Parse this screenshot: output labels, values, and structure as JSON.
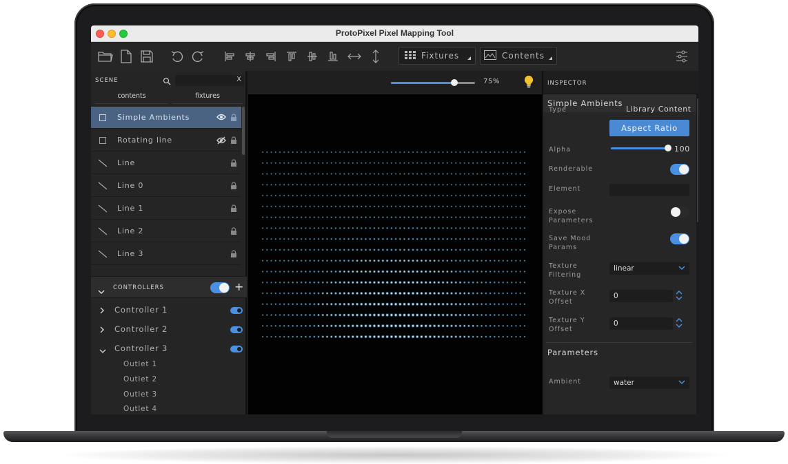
{
  "window": {
    "title": "ProtoPixel Pixel Mapping Tool"
  },
  "toolbar": {
    "fixtures_label": "Fixtures",
    "contents_label": "Contents",
    "icons": [
      "open-folder-icon",
      "new-file-icon",
      "save-icon",
      "undo-icon",
      "redo-icon",
      "align-left-icon",
      "align-center-horizontal-icon",
      "align-right-icon",
      "align-top-icon",
      "align-center-vertical-icon",
      "align-bottom-icon",
      "distribute-horizontal-icon",
      "distribute-vertical-icon",
      "grid-icon",
      "image-icon",
      "sliders-icon"
    ]
  },
  "scene": {
    "header": "SCENE",
    "search_clear": "X",
    "tabs": [
      "contents",
      "fixtures"
    ],
    "items": [
      {
        "label": "Simple Ambients",
        "kind": "content",
        "selected": true,
        "visible": true
      },
      {
        "label": "Rotating line",
        "kind": "content",
        "selected": false,
        "visible": false
      },
      {
        "label": "Line",
        "kind": "line"
      },
      {
        "label": "Line 0",
        "kind": "line"
      },
      {
        "label": "Line 1",
        "kind": "line"
      },
      {
        "label": "Line 2",
        "kind": "line"
      },
      {
        "label": "Line 3",
        "kind": "line"
      }
    ]
  },
  "controllers": {
    "header": "CONTROLLERS",
    "add_label": "+",
    "enabled": true,
    "items": [
      {
        "label": "Controller 1",
        "expanded": false
      },
      {
        "label": "Controller 2",
        "expanded": false
      },
      {
        "label": "Controller 3",
        "expanded": true
      }
    ],
    "outlets": [
      "Outlet 1",
      "Outlet 2",
      "Outlet 3",
      "Outlet 4"
    ]
  },
  "canvas": {
    "zoom_label": "75%",
    "zoom_fraction": 0.75,
    "led_rows": 18,
    "led_cols": 62
  },
  "inspector": {
    "header": "INSPECTOR",
    "title": "Simple Ambients",
    "type_label": "Type",
    "type_value": "Library Content",
    "aspect_button": "Aspect Ratio",
    "alpha_label": "Alpha",
    "alpha_value": "100",
    "renderable_label": "Renderable",
    "element_label": "Element",
    "expose_label_1": "Expose",
    "expose_label_2": "Parameters",
    "save_label_1": "Save Mood",
    "save_label_2": "Params",
    "filtering_label_1": "Texture",
    "filtering_label_2": "Filtering",
    "filtering_value": "linear",
    "offset_x_label_1": "Texture X",
    "offset_x_label_2": "Offset",
    "offset_x_value": "0",
    "offset_y_label_1": "Texture Y",
    "offset_y_label_2": "Offset",
    "offset_y_value": "0",
    "parameters_header": "Parameters",
    "ambient_label": "Ambient",
    "ambient_value": "water",
    "accent": "#4a90e2"
  }
}
